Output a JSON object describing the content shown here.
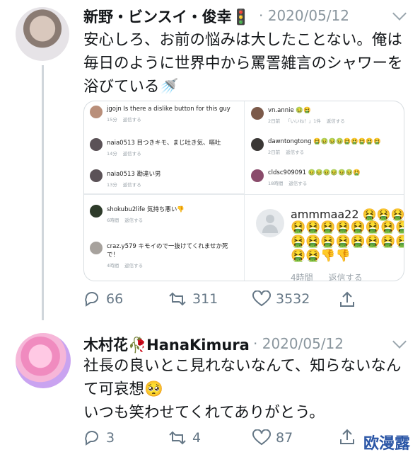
{
  "tweet1": {
    "name": "新野・ビンスイ・俊幸🚦",
    "handle": "· 2020/05/12",
    "text": "安心しろ、お前の悩みは大したことない。俺は毎日のように世界中から罵詈雑言のシャワーを浴びている🚿",
    "media": {
      "comments": [
        {
          "user": "jgojn Is there a dislike button for this guy",
          "time": "15分",
          "reply": "返信する",
          "color": "#b98f7a"
        },
        {
          "user": "naia0513 目つきキモ、まじ吐き気、嘔吐",
          "time": "14分",
          "reply": "返信する",
          "color": "#5b5257"
        },
        {
          "user": "naia0513 勘違い男",
          "time": "13分",
          "reply": "返信する",
          "color": "#5b5257"
        },
        {
          "user": "vn.annie 🤢🤮",
          "time": "2日前",
          "likes": "「いいね！」1件",
          "reply": "返信する",
          "color": "#7c5a4a"
        },
        {
          "user": "dawntongtong 🤮🤢🤢🤢🤮🤮🤮🤮🤮",
          "time": "2日前",
          "reply": "返信する",
          "color": "#3b3836"
        },
        {
          "user": "cldsc909091 🤢🤢🤢🤢🤢🤢🤮",
          "time": "18時間",
          "reply": "返信する",
          "color": "#8a4b6b"
        },
        {
          "user": "shokubu2life 気持ち悪い👎",
          "time": "6時間",
          "reply": "返信する",
          "color": "#2e3b2a"
        },
        {
          "user": "craz.y579 キモイので一抜けてくれませか死で！",
          "time": "4時間",
          "reply": "返信する",
          "color": "#a7a29d"
        }
      ],
      "big": {
        "user": "ammmaa22 🤮🤮🤮",
        "emoji": "🤮🤮🤮🤮🤮🤮🤮🤮🤮🤮🤮🤮🤮🤮🤮🤮🤮🤮👎👎",
        "time": "4時間",
        "reply": "返信する"
      }
    },
    "actions": {
      "reply": "66",
      "retweet": "311",
      "like": "3532"
    }
  },
  "tweet2": {
    "name": "木村花🥀HanaKimura",
    "handle": "· 2020/05/12",
    "text": "社長の良いとこ見れないなんて、知らないなんて可哀想🥺\nいつも笑わせてくれてありがとう。",
    "actions": {
      "reply": "3",
      "retweet": "4",
      "like": "87"
    }
  },
  "watermark": "欧漫露"
}
